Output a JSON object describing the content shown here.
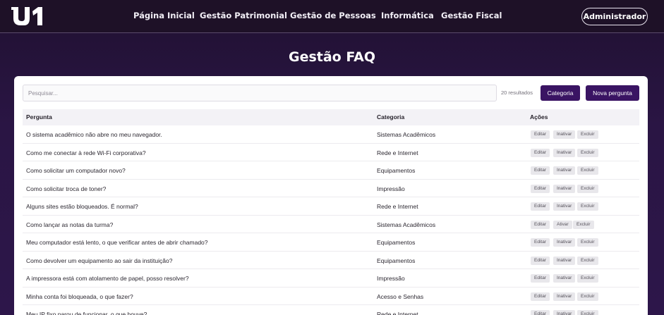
{
  "header": {
    "logo_text": "U1",
    "nav": [
      {
        "label": "Página Inicial"
      },
      {
        "label": "Gestão Patrimonial"
      },
      {
        "label": "Gestão de Pessoas"
      },
      {
        "label": "Informática"
      },
      {
        "label": "Gestão Fiscal"
      }
    ],
    "user_label": "Administrador"
  },
  "page": {
    "title": "Gestão FAQ"
  },
  "toolbar": {
    "search_placeholder": "Pesquisar...",
    "results_text": "20 resultados",
    "category_button": "Categoria",
    "new_button": "Nova pergunta"
  },
  "table": {
    "columns": [
      "Pergunta",
      "Categoria",
      "Ações"
    ],
    "actions": {
      "edit": "Editar",
      "deactivate": "Inativar",
      "activate": "Ativar",
      "delete": "Excluir"
    },
    "rows": [
      {
        "question": "O sistema acadêmico não abre no meu navegador.",
        "category": "Sistemas Acadêmicos",
        "toggle": "Inativar"
      },
      {
        "question": "Como me conectar à rede Wi-Fi corporativa?",
        "category": "Rede e Internet",
        "toggle": "Inativar"
      },
      {
        "question": "Como solicitar um computador novo?",
        "category": "Equipamentos",
        "toggle": "Inativar"
      },
      {
        "question": "Como solicitar troca de toner?",
        "category": "Impressão",
        "toggle": "Inativar"
      },
      {
        "question": "Alguns sites estão bloqueados. É normal?",
        "category": "Rede e Internet",
        "toggle": "Inativar"
      },
      {
        "question": "Como lançar as notas da turma?",
        "category": "Sistemas Acadêmicos",
        "toggle": "Ativar"
      },
      {
        "question": "Meu computador está lento, o que verificar antes de abrir chamado?",
        "category": "Equipamentos",
        "toggle": "Inativar"
      },
      {
        "question": "Como devolver um equipamento ao sair da instituição?",
        "category": "Equipamentos",
        "toggle": "Inativar"
      },
      {
        "question": "A impressora está com atolamento de papel, posso resolver?",
        "category": "Impressão",
        "toggle": "Inativar"
      },
      {
        "question": "Minha conta foi bloqueada, o que fazer?",
        "category": "Acesso e Senhas",
        "toggle": "Inativar"
      },
      {
        "question": "Meu IP fixo parou de funcionar, o que houve?",
        "category": "Rede e Internet",
        "toggle": "Inativar"
      }
    ]
  }
}
